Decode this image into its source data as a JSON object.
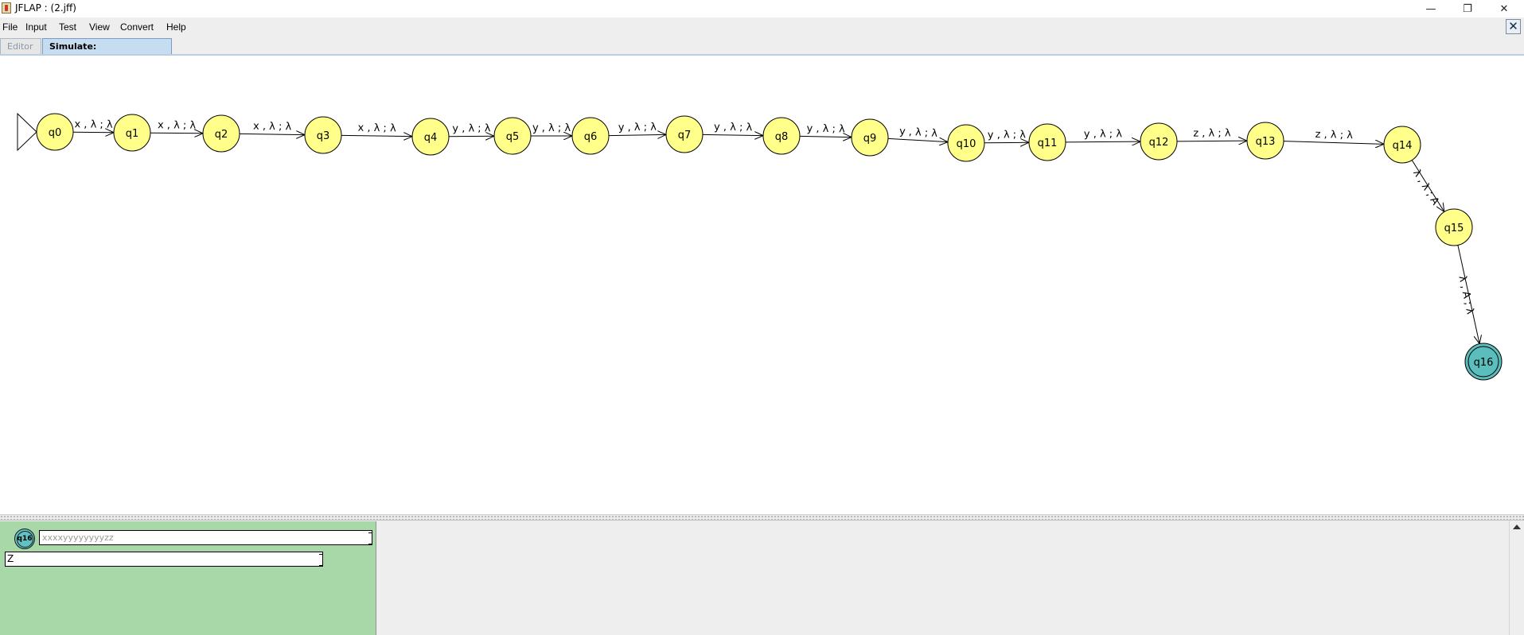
{
  "window": {
    "title": "JFLAP : (2.jff)",
    "controls": {
      "minimize": "—",
      "maximize": "❐",
      "close": "✕"
    }
  },
  "menu": {
    "items": [
      "File",
      "Input",
      "Test",
      "View",
      "Convert",
      "Help"
    ]
  },
  "tabs": {
    "editor": "Editor",
    "simulate": "Simulate: xxxxyyyyyyyyzz"
  },
  "automaton": {
    "initial_state": "q0",
    "final_state": "q16",
    "colors": {
      "state_fill": "#ffff8a",
      "final_fill": "#5cbdbd",
      "edge": "#000000"
    },
    "states": [
      {
        "id": "q0"
      },
      {
        "id": "q1"
      },
      {
        "id": "q2"
      },
      {
        "id": "q3"
      },
      {
        "id": "q4"
      },
      {
        "id": "q5"
      },
      {
        "id": "q6"
      },
      {
        "id": "q7"
      },
      {
        "id": "q8"
      },
      {
        "id": "q9"
      },
      {
        "id": "q10"
      },
      {
        "id": "q11"
      },
      {
        "id": "q12"
      },
      {
        "id": "q13"
      },
      {
        "id": "q14"
      },
      {
        "id": "q15"
      },
      {
        "id": "q16",
        "final": true
      }
    ],
    "transitions": [
      {
        "from": "q0",
        "to": "q1",
        "label": "x , λ ; λ"
      },
      {
        "from": "q1",
        "to": "q2",
        "label": "x , λ ; λ"
      },
      {
        "from": "q2",
        "to": "q3",
        "label": "x , λ ; λ"
      },
      {
        "from": "q3",
        "to": "q4",
        "label": "x , λ ; λ"
      },
      {
        "from": "q4",
        "to": "q5",
        "label": "y , λ ; λ"
      },
      {
        "from": "q5",
        "to": "q6",
        "label": "y , λ ; λ"
      },
      {
        "from": "q6",
        "to": "q7",
        "label": "y , λ ; λ"
      },
      {
        "from": "q7",
        "to": "q8",
        "label": "y , λ ; λ"
      },
      {
        "from": "q8",
        "to": "q9",
        "label": "y , λ ; λ"
      },
      {
        "from": "q9",
        "to": "q10",
        "label": "y , λ ; λ"
      },
      {
        "from": "q10",
        "to": "q11",
        "label": "y , λ ; λ"
      },
      {
        "from": "q11",
        "to": "q12",
        "label": "y , λ ; λ"
      },
      {
        "from": "q12",
        "to": "q13",
        "label": "z , λ ; λ"
      },
      {
        "from": "q13",
        "to": "q14",
        "label": "z , λ ; λ"
      },
      {
        "from": "q14",
        "to": "q15",
        "label": "λ , λ ; A"
      },
      {
        "from": "q15",
        "to": "q16",
        "label": "λ , A ; λ"
      }
    ]
  },
  "simulation": {
    "configuration": {
      "state": "q16",
      "input": "xxxxyyyyyyyyzz",
      "stack": "Z",
      "color": "#a8d8a8"
    }
  }
}
